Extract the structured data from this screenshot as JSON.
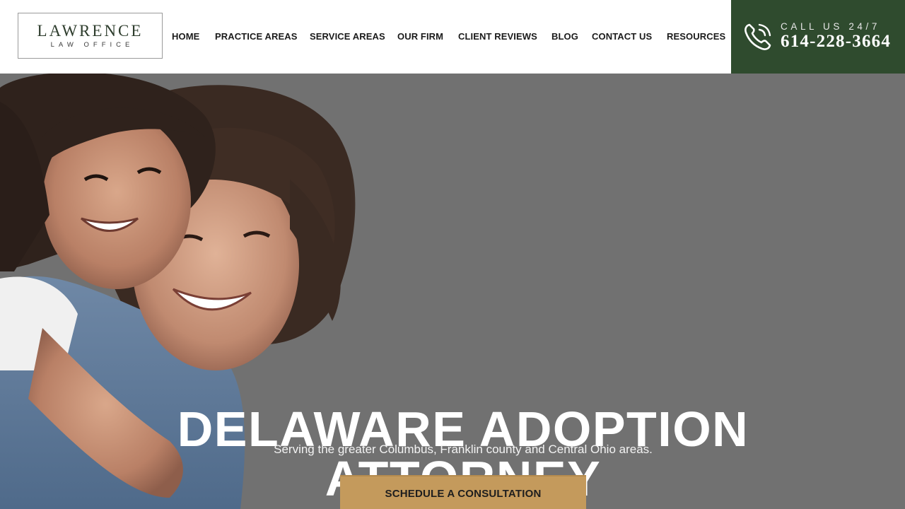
{
  "logo": {
    "name": "LAWRENCE",
    "tagline": "LAW OFFICE"
  },
  "nav": {
    "items": [
      "HOME",
      "PRACTICE AREAS",
      "SERVICE AREAS",
      "OUR FIRM",
      "CLIENT REVIEWS",
      "BLOG",
      "CONTACT US",
      "RESOURCES"
    ]
  },
  "call": {
    "label": "CALL US 24/7",
    "number": "614-228-3664"
  },
  "hero": {
    "title_line1": "DELAWARE ADOPTION",
    "title_line2": "ATTORNEY",
    "subtitle": "Serving the greater Columbus, Franklin county and Central Ohio areas.",
    "cta_label": "SCHEDULE A CONSULTATION"
  },
  "colors": {
    "call_box": "#2f4b2e",
    "cta": "#c49a5c",
    "hero_overlay": "#717171"
  },
  "icons": {
    "phone": "phone-icon"
  },
  "image": {
    "hero_photo": "mother and daughter smiling"
  }
}
